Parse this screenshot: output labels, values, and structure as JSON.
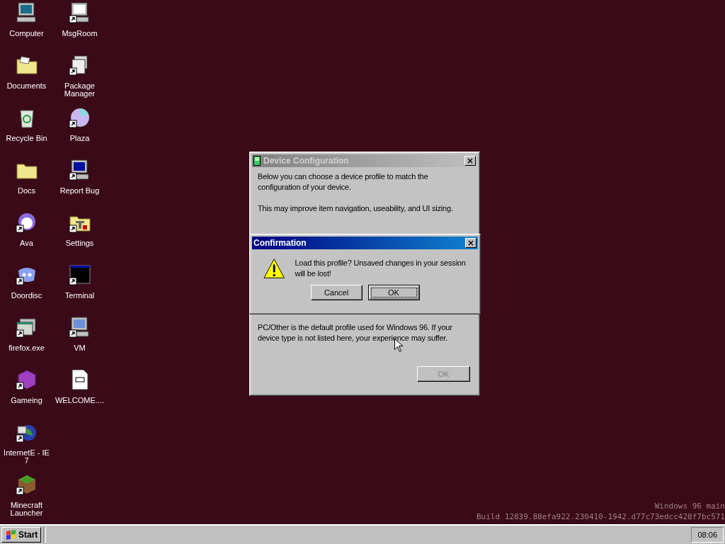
{
  "desktop": {
    "icons": [
      {
        "label": "Computer",
        "shortcut": false
      },
      {
        "label": "Documents",
        "shortcut": false
      },
      {
        "label": "Recycle Bin",
        "shortcut": false
      },
      {
        "label": "Docs",
        "shortcut": false
      },
      {
        "label": "Ava",
        "shortcut": true
      },
      {
        "label": "Doordisc",
        "shortcut": true
      },
      {
        "label": "firefox.exe",
        "shortcut": true
      },
      {
        "label": "Gameing",
        "shortcut": true
      },
      {
        "label": "InternetE - IE 7",
        "shortcut": true
      },
      {
        "label": "Minecraft Launcher",
        "shortcut": true
      },
      {
        "label": "MsgRoom",
        "shortcut": true
      },
      {
        "label": "Package Manager",
        "shortcut": true
      },
      {
        "label": "Plaza",
        "shortcut": true
      },
      {
        "label": "Report Bug",
        "shortcut": true
      },
      {
        "label": "Settings",
        "shortcut": true
      },
      {
        "label": "Terminal",
        "shortcut": true
      },
      {
        "label": "VM",
        "shortcut": true
      },
      {
        "label": "WELCOME....",
        "shortcut": false
      }
    ],
    "build_info": [
      "Windows 96 main",
      "Build 12839.88efa922.230410-1942.d77c73edcc428f7bc571"
    ]
  },
  "device_window": {
    "title": "Device Configuration",
    "active": false,
    "close": "×",
    "paragraphs": [
      "Below you can choose a device profile to match the configuration of your device.",
      "This may improve item navigation, useability, and UI sizing."
    ],
    "note": "PC/Other is the default profile used for Windows 96. If your device type is not listed here, your experience may suffer.",
    "button": {
      "label": "OK",
      "disabled": true
    }
  },
  "confirmation": {
    "title": "Confirmation",
    "active": true,
    "close": "×",
    "message": "Load this profile? Unsaved changes in your session will be lost!",
    "buttons": [
      {
        "label": "Cancel",
        "focused": false
      },
      {
        "label": "OK",
        "focused": true
      }
    ]
  },
  "taskbar": {
    "start": "Start",
    "clock": "08:06"
  }
}
